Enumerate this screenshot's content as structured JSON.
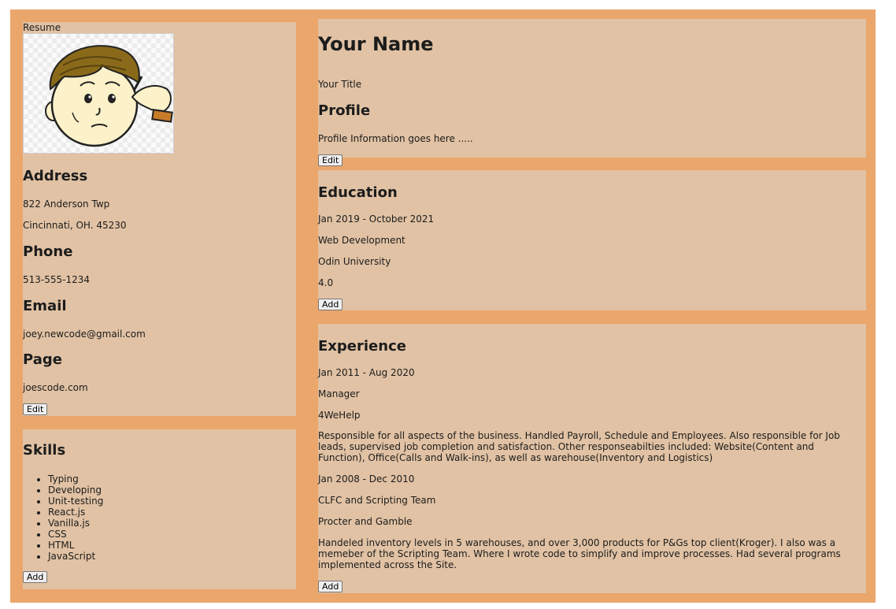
{
  "sidebar": {
    "resume_label": "Resume",
    "photo_name": "cartoon-boy-thinking",
    "address": {
      "heading": "Address",
      "line1": "822 Anderson Twp",
      "line2": "Cincinnati, OH. 45230"
    },
    "phone": {
      "heading": "Phone",
      "value": "513-555-1234"
    },
    "email": {
      "heading": "Email",
      "value": "joey.newcode@gmail.com"
    },
    "page": {
      "heading": "Page",
      "value": "joescode.com"
    },
    "edit_label": "Edit"
  },
  "skills": {
    "heading": "Skills",
    "items": [
      "Typing",
      "Developing",
      "Unit-testing",
      "React.js",
      "Vanilla.js",
      "CSS",
      "HTML",
      "JavaScript"
    ],
    "add_label": "Add"
  },
  "profile": {
    "name": "Your Name",
    "title": "Your Title",
    "heading": "Profile",
    "info": "Profile Information goes here .....",
    "edit_label": "Edit"
  },
  "education": {
    "heading": "Education",
    "dates": "Jan 2019 - October 2021",
    "field": "Web Development",
    "school": "Odin University",
    "gpa": "4.0",
    "add_label": "Add"
  },
  "experience": {
    "heading": "Experience",
    "jobs": [
      {
        "dates": "Jan 2011 - Aug 2020",
        "role": "Manager",
        "company": "4WeHelp",
        "description": "Responsible for all aspects of the business. Handled Payroll, Schedule and Employees. Also responsible for Job leads, supervised job completion and satisfaction. Other responseabilties included: Website(Content and Function), Office(Calls and Walk-ins), as well as warehouse(Inventory and Logistics)"
      },
      {
        "dates": "Jan 2008 - Dec 2010",
        "role": "CLFC and Scripting Team",
        "company": "Procter and Gamble",
        "description": "Handeled inventory levels in 5 warehouses, and over 3,000 products for P&Gs top client(Kroger). I also was a memeber of the Scripting Team. Where I wrote code to simplify and improve processes. Had several programs implemented across the Site."
      }
    ],
    "add_label": "Add"
  }
}
